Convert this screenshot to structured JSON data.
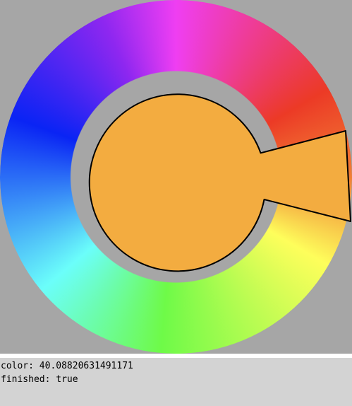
{
  "picker": {
    "selected_hue": 40.08820631491171,
    "selected_color": "#f3ac40",
    "background_color": "#a6a6a6",
    "ring_colors": {
      "magenta": "#ef3ef2",
      "red": "#ec3a26",
      "orange": "#f07e34",
      "yellow": "#fefe5b",
      "green": "#6efa48",
      "cyan": "#6bfefa",
      "blue": "#0a24f4",
      "purple": "#8e27f0"
    },
    "selector_outline_color": "#000000"
  },
  "status": {
    "color_label": "color:",
    "color_value": "40.08820631491171",
    "finished_label": "finished:",
    "finished_value": "true"
  }
}
